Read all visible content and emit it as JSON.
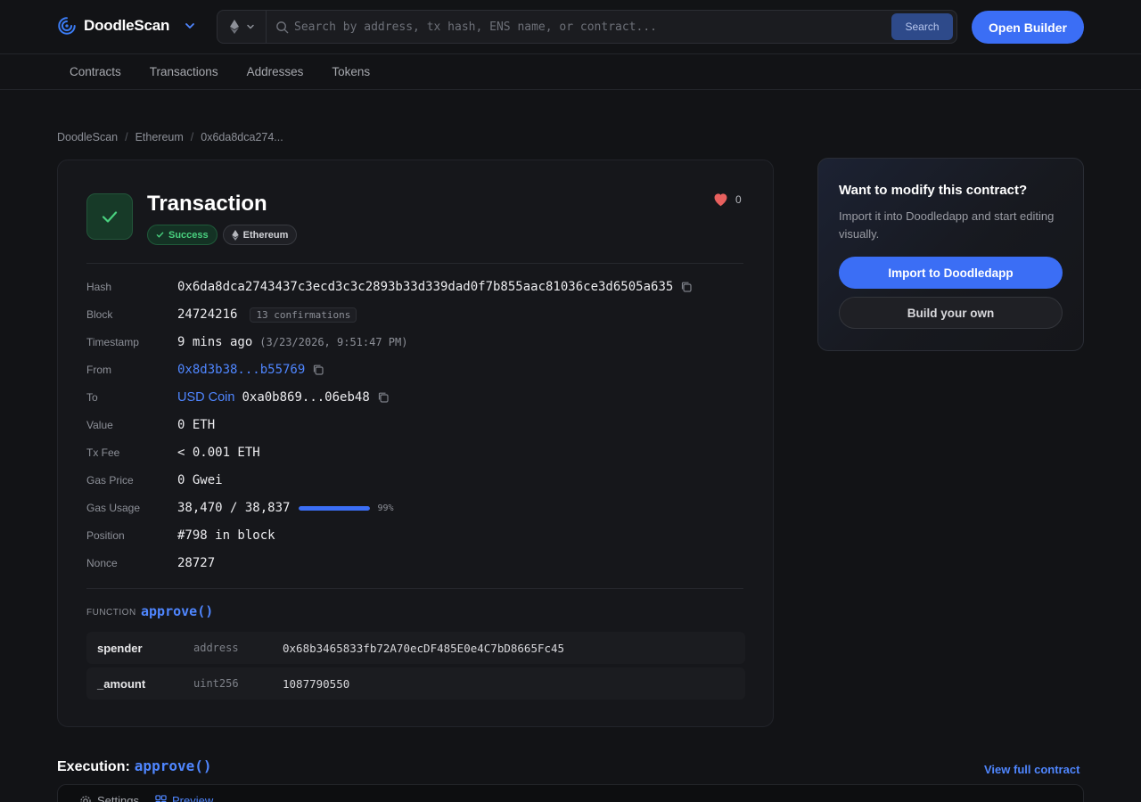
{
  "brand": {
    "name": "DoodleScan"
  },
  "search": {
    "placeholder": "Search by address, tx hash, ENS name, or contract...",
    "button": "Search"
  },
  "header": {
    "open_builder": "Open Builder"
  },
  "nav": {
    "items": [
      "Contracts",
      "Transactions",
      "Addresses",
      "Tokens"
    ]
  },
  "breadcrumb": [
    "DoodleScan",
    "Ethereum",
    "0x6da8dca274..."
  ],
  "transaction": {
    "title": "Transaction",
    "status": "Success",
    "chain": "Ethereum",
    "likes": "0",
    "fields": {
      "hash": {
        "label": "Hash",
        "value": "0x6da8dca2743437c3ecd3c3c2893b33d339dad0f7b855aac81036ce3d6505a635"
      },
      "block": {
        "label": "Block",
        "value": "24724216",
        "confirmations": "13 confirmations"
      },
      "timestamp": {
        "label": "Timestamp",
        "relative": "9 mins ago",
        "absolute": "(3/23/2026, 9:51:47 PM)"
      },
      "from": {
        "label": "From",
        "value": "0x8d3b38...b55769"
      },
      "to": {
        "label": "To",
        "name": "USD Coin",
        "value": "0xa0b869...06eb48"
      },
      "value": {
        "label": "Value",
        "value": "0 ETH"
      },
      "tx_fee": {
        "label": "Tx Fee",
        "value": "< 0.001 ETH"
      },
      "gas_price": {
        "label": "Gas Price",
        "value": "0 Gwei"
      },
      "gas_usage": {
        "label": "Gas Usage",
        "value": "38,470 / 38,837",
        "percent_label": "99%",
        "fraction": 0.99
      },
      "position": {
        "label": "Position",
        "value": "#798 in block"
      },
      "nonce": {
        "label": "Nonce",
        "value": "28727"
      }
    },
    "function": {
      "label": "FUNCTION",
      "name": "approve()",
      "params": [
        {
          "name": "spender",
          "type": "address",
          "value": "0x68b3465833fb72A70ecDF485E0e4C7bD8665Fc45"
        },
        {
          "name": "_amount",
          "type": "uint256",
          "value": "1087790550"
        }
      ]
    }
  },
  "side_card": {
    "title": "Want to modify this contract?",
    "description": "Import it into Doodledapp and start editing visually.",
    "import_button": "Import to Doodledapp",
    "build_button": "Build your own"
  },
  "execution": {
    "title": "Execution:",
    "function": "approve()",
    "view_full": "View full contract",
    "tabs": [
      "Settings",
      "Preview"
    ]
  },
  "colors": {
    "accent": "#3b6ef5",
    "link": "#4f86ff",
    "success": "#49d17f",
    "background": "#121316"
  }
}
